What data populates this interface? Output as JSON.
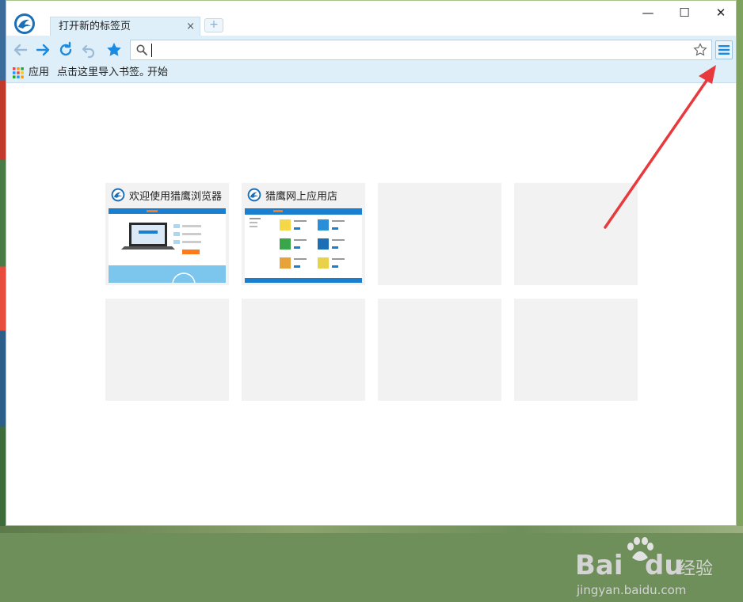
{
  "window": {
    "tab_title": "打开新的标签页",
    "tab_close": "×",
    "new_tab": "+"
  },
  "controls": {
    "minimize": "—",
    "maximize": "☐",
    "close": "✕"
  },
  "address_bar": {
    "value": "",
    "placeholder": ""
  },
  "bookmarks": {
    "apps": "应用",
    "import_hint": "点击这里导入书签。",
    "start": "开始"
  },
  "tiles": [
    {
      "title": "欢迎使用猎鹰浏览器",
      "thumb": "welcome"
    },
    {
      "title": "猎鹰网上应用店",
      "thumb": "store"
    },
    {
      "title": "",
      "thumb": ""
    },
    {
      "title": "",
      "thumb": ""
    },
    {
      "title": "",
      "thumb": ""
    },
    {
      "title": "",
      "thumb": ""
    },
    {
      "title": "",
      "thumb": ""
    },
    {
      "title": "",
      "thumb": ""
    }
  ],
  "watermark": {
    "brand": "Bai",
    "brand2": "du",
    "cn": "经验",
    "url": "jingyan.baidu.com"
  },
  "colors": {
    "accent": "#1a8be0",
    "toolbar": "#deeffa",
    "arrow": "#e8393c"
  }
}
